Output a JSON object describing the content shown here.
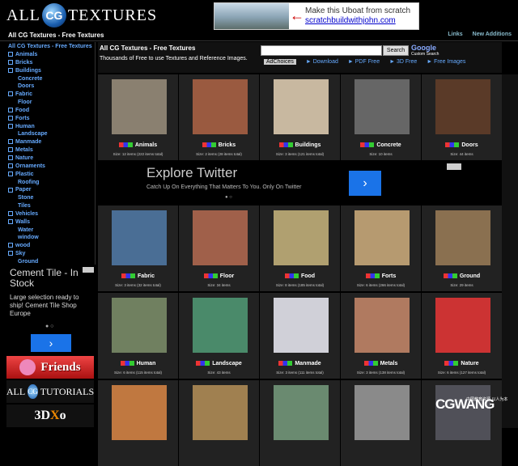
{
  "logo": {
    "all": "ALL",
    "cg": "CG",
    "textures": "TEXTURES"
  },
  "top_ad": {
    "line1": "Make this Uboat from scratch",
    "line2": "scratchbuildwithjohn.com",
    "arrow": "←"
  },
  "navbar": {
    "title": "All CG Textures - Free Textures",
    "links": "Links",
    "new_additions": "New Additions"
  },
  "sidebar": {
    "home": "All CG Textures - Free Textures",
    "items": [
      {
        "label": "Animals",
        "sub": false
      },
      {
        "label": "Bricks",
        "sub": false
      },
      {
        "label": "Buildings",
        "sub": false
      },
      {
        "label": "Concrete",
        "sub": true
      },
      {
        "label": "Doors",
        "sub": true
      },
      {
        "label": "Fabric",
        "sub": false
      },
      {
        "label": "Floor",
        "sub": true
      },
      {
        "label": "Food",
        "sub": false
      },
      {
        "label": "Forts",
        "sub": false
      },
      {
        "label": "Human",
        "sub": false
      },
      {
        "label": "Landscape",
        "sub": true
      },
      {
        "label": "Manmade",
        "sub": false
      },
      {
        "label": "Metals",
        "sub": false
      },
      {
        "label": "Nature",
        "sub": false
      },
      {
        "label": "Ornaments",
        "sub": false
      },
      {
        "label": "Plastic",
        "sub": false
      },
      {
        "label": "Roofing",
        "sub": true
      },
      {
        "label": "Paper",
        "sub": false
      },
      {
        "label": "Stone",
        "sub": true
      },
      {
        "label": "Tiles",
        "sub": true
      },
      {
        "label": "Vehicles",
        "sub": false
      },
      {
        "label": "Walls",
        "sub": false
      },
      {
        "label": "Water",
        "sub": true
      },
      {
        "label": "window",
        "sub": true
      },
      {
        "label": "wood",
        "sub": false
      },
      {
        "label": "Sky",
        "sub": false
      },
      {
        "label": "Ground",
        "sub": true
      }
    ]
  },
  "side_ad": {
    "title": "Cement Tile - In Stock",
    "desc": "Large selection ready to ship! Cement Tile Shop Europe",
    "dots": "● ○",
    "go": "›"
  },
  "banners": {
    "friends": "Friends",
    "tutorials_all": "ALL",
    "tutorials_cg": "CG",
    "tutorials": "TUTORIALS",
    "three_d": "3D",
    "x": "X",
    "o": "o"
  },
  "main_header": {
    "title": "All CG Textures - Free Textures",
    "subtitle": "Thousands of Free to use Textures and Reference Images."
  },
  "search": {
    "button": "Search",
    "google": "Google",
    "custom": "Custom Search"
  },
  "ad_links": {
    "adchoices": "AdChoices",
    "links": [
      "► Download",
      "► PDF Free",
      "► 3D Free",
      "► Free Images"
    ]
  },
  "mid_ad": {
    "title": "Explore Twitter",
    "desc": "Catch Up On Everything That Matters To You. Only On Twitter",
    "go": "›",
    "dots": "● ○"
  },
  "categories": [
    {
      "name": "Animals",
      "size": "Size: 12 items (222 items total)",
      "color": "#8a8070"
    },
    {
      "name": "Bricks",
      "size": "Size: 2 items (28 items total)",
      "color": "#9a5a40"
    },
    {
      "name": "Buildings",
      "size": "Size: 3 items (121 items total)",
      "color": "#c8b8a0"
    },
    {
      "name": "Concrete",
      "size": "Size: 10 items",
      "color": "#666666"
    },
    {
      "name": "Doors",
      "size": "Size: 44 items",
      "color": "#5a3a28"
    },
    {
      "name": "Fabric",
      "size": "Size: 3 items (32 items total)",
      "color": "#4a6e95"
    },
    {
      "name": "Floor",
      "size": "Size: 34 items",
      "color": "#a0604a"
    },
    {
      "name": "Food",
      "size": "Size: 8 items (185 items total)",
      "color": "#b0a070"
    },
    {
      "name": "Forts",
      "size": "Size: 6 items (266 items total)",
      "color": "#b69a70"
    },
    {
      "name": "Ground",
      "size": "Size: 29 items",
      "color": "#8a7050"
    },
    {
      "name": "Human",
      "size": "Size: 6 items (115 items total)",
      "color": "#708060"
    },
    {
      "name": "Landscape",
      "size": "Size: 43 items",
      "color": "#4a8a6a"
    },
    {
      "name": "Manmade",
      "size": "Size: 3 items (111 items total)",
      "color": "#d0d0d8"
    },
    {
      "name": "Metals",
      "size": "Size: 3 items (138 items total)",
      "color": "#b07a60"
    },
    {
      "name": "Nature",
      "size": "Size: 6 items (127 items total)",
      "color": "#cc3333"
    },
    {
      "name": "",
      "size": "",
      "color": "#c07840"
    },
    {
      "name": "",
      "size": "",
      "color": "#a08050"
    },
    {
      "name": "",
      "size": "",
      "color": "#6a8a70"
    },
    {
      "name": "",
      "size": "",
      "color": "#8a8a8a"
    },
    {
      "name": "",
      "size": "",
      "color": "#505058"
    }
  ],
  "watermark": {
    "brand": "CGWANG",
    "slogan": "中国教育资源,以人为本"
  }
}
